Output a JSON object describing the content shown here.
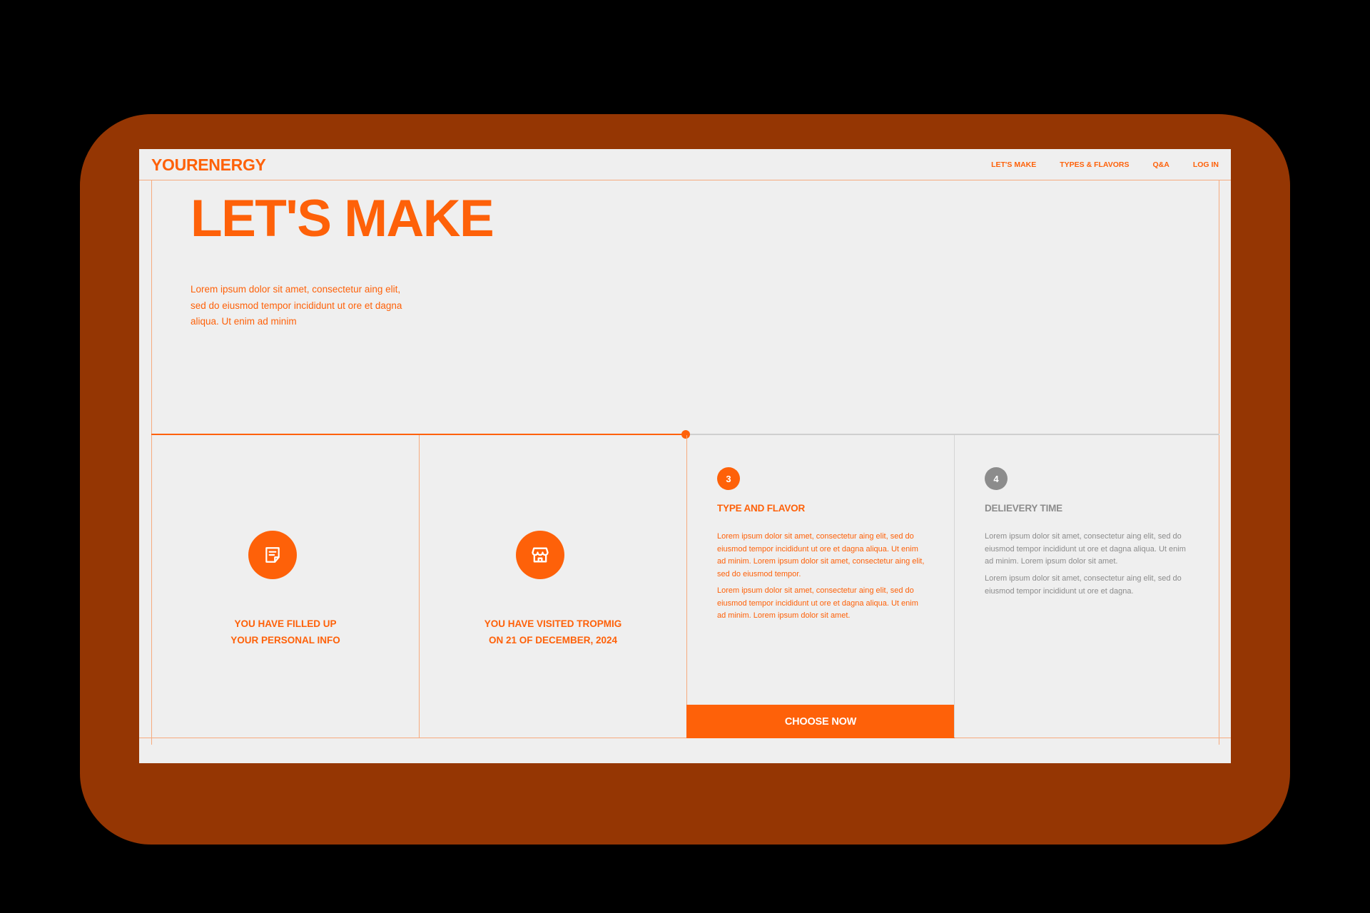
{
  "colors": {
    "accent": "#fe6109",
    "backdrop": "#953603",
    "page_background": "#efefef",
    "muted": "#8c8c8c",
    "divider": "#f6aa7e"
  },
  "brand": {
    "logo": "YOURENERGY"
  },
  "nav": {
    "items": [
      {
        "label": "LET'S MAKE"
      },
      {
        "label": "TYPES & FLAVORS"
      },
      {
        "label": "Q&A"
      },
      {
        "label": "LOG IN"
      }
    ]
  },
  "hero": {
    "title": "LET'S MAKE",
    "text": "Lorem ipsum dolor sit amet, consectetur aing elit, sed do eiusmod  tempor incididunt ut ore et dagna aliqua. Ut enim ad minim"
  },
  "progress": {
    "completed_fraction": 0.5
  },
  "steps": [
    {
      "status": "done",
      "icon": "note-icon",
      "line1": "YOU HAVE FILLED UP",
      "line2": "YOUR PERSONAL INFO"
    },
    {
      "status": "done",
      "icon": "store-icon",
      "line1": "YOU HAVE VISITED TROPMIG",
      "line2": "ON 21 OF DECEMBER, 2024"
    },
    {
      "status": "active",
      "number": "3",
      "title": "TYPE AND FLAVOR",
      "paragraph1": "Lorem ipsum dolor sit amet, consectetur aing elit, sed do eiusmod  tempor incididunt ut ore et dagna aliqua. Ut enim ad minim. Lorem ipsum dolor sit amet, consectetur aing elit, sed do eiusmod  tempor.",
      "paragraph2": "Lorem ipsum dolor sit amet, consectetur aing elit, sed do eiusmod  tempor incididunt ut ore et dagna aliqua. Ut enim ad minim. Lorem ipsum dolor sit amet.",
      "button": "CHOOSE NOW"
    },
    {
      "status": "upcoming",
      "number": "4",
      "title": "DELIEVERY TIME",
      "paragraph1": "Lorem ipsum dolor sit amet, consectetur aing elit, sed do eiusmod  tempor incididunt ut ore et dagna aliqua. Ut enim ad minim. Lorem ipsum dolor sit amet.",
      "paragraph2": "Lorem ipsum dolor sit amet, consectetur aing elit, sed do eiusmod  tempor incididunt ut ore et dagna."
    }
  ]
}
